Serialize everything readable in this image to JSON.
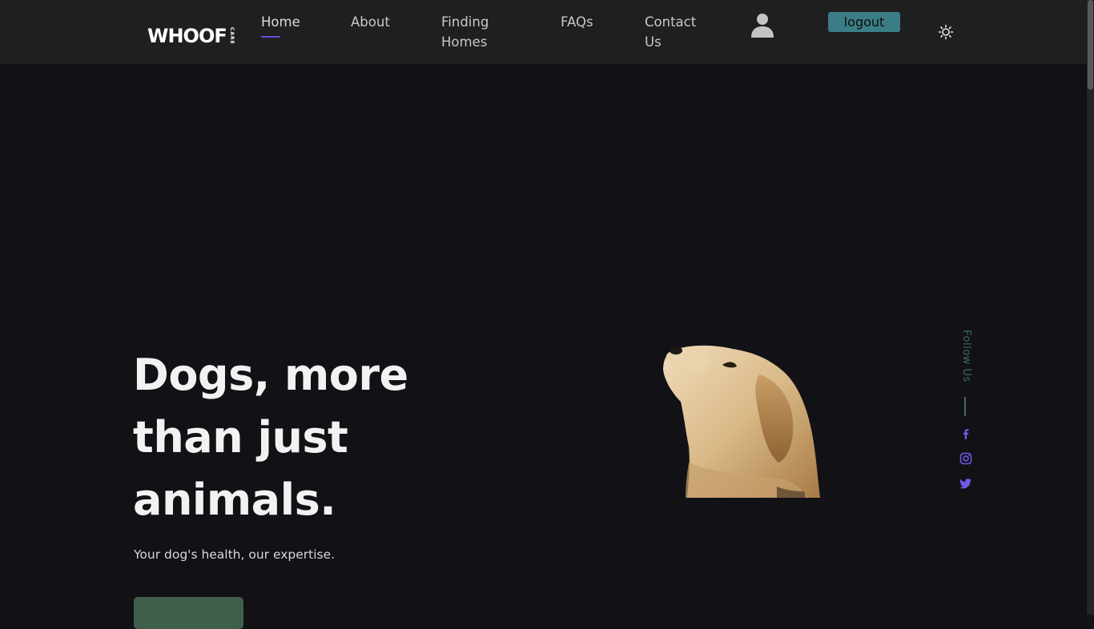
{
  "header": {
    "logo": {
      "word": "WHOOF",
      "sub": "CARE"
    },
    "nav": [
      {
        "label": "Home",
        "active": true
      },
      {
        "label": "About",
        "active": false
      },
      {
        "label": "Finding Homes",
        "active": false
      },
      {
        "label": "FAQs",
        "active": false
      },
      {
        "label": "Contact Us",
        "active": false
      }
    ],
    "user_icon": "user-icon",
    "logout_label": "logout",
    "theme_icon": "sun-icon"
  },
  "hero": {
    "title": "Dogs, more than just animals.",
    "subtitle": "Your dog's health, our expertise.",
    "image": "golden-retriever-dog"
  },
  "social": {
    "label": "Follow Us",
    "icons": [
      "facebook-icon",
      "instagram-icon",
      "twitter-icon"
    ]
  },
  "colors": {
    "background": "#111116",
    "header": "#1f1f1f",
    "accent": "#5b52d6",
    "logout": "#3b7d86",
    "cta": "#3f5f4c",
    "follow": "#3f6e55"
  }
}
